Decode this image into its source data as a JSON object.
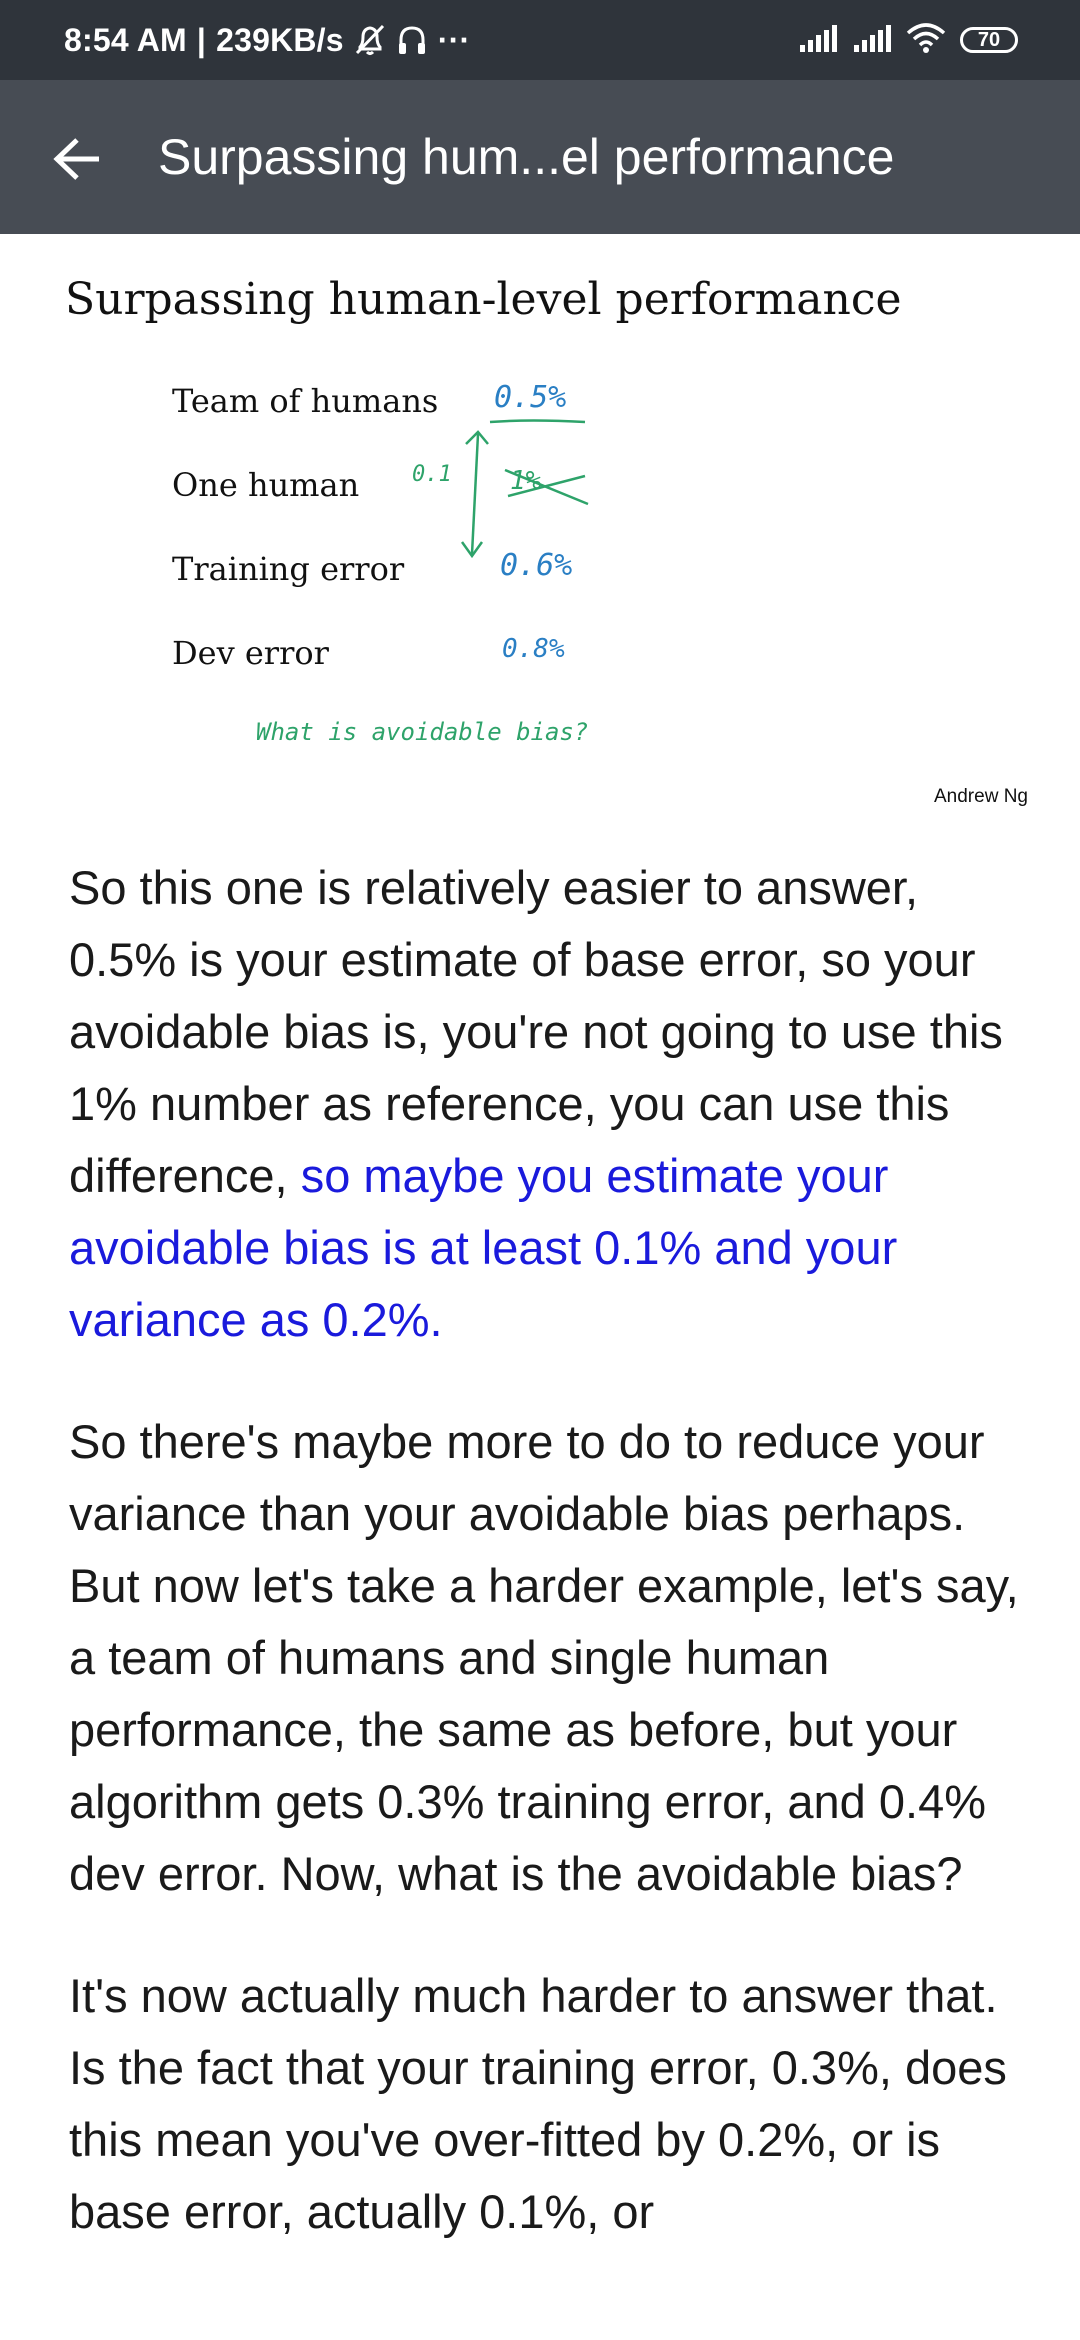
{
  "status_bar": {
    "time": "8:54 AM",
    "separator": "|",
    "speed": "239KB/s",
    "icons": [
      "bell-muted-icon",
      "headphones-icon",
      "more-dots-icon",
      "signal-icon",
      "signal-icon",
      "wifi-icon",
      "battery-icon"
    ],
    "more": "···",
    "battery": "70"
  },
  "app_bar": {
    "back_icon": "arrow-left-icon",
    "title": "Surpassing hum...el performance"
  },
  "slide": {
    "title": "Surpassing human-level performance",
    "rows": [
      {
        "label": "Team of humans",
        "value": "0.5%"
      },
      {
        "label": "One human",
        "value": "1%"
      },
      {
        "label": "Training error",
        "value": "0.6%"
      },
      {
        "label": "Dev error",
        "value": "0.8%"
      }
    ],
    "gap_note": "0.1",
    "question": "What is avoidable bias?",
    "credit": "Andrew Ng",
    "colors": {
      "ink_blue": "#2a7fc4",
      "ink_green": "#2ea36a"
    }
  },
  "article": {
    "p1_plain": "So this one is relatively easier to answer, 0.5% is your estimate of base error, so your avoidable bias is, you're not going to use this 1% number as reference, you can use this difference, ",
    "p1_highlight": "so maybe you estimate your avoidable bias is at least 0.1% and your variance as 0.2%.",
    "p2": "So there's maybe more to do to reduce your variance than your avoidable bias perhaps. But now let's take a harder example, let's say, a team of humans and single human performance, the same as before, but your algorithm gets 0.3% training error, and 0.4% dev error. Now, what is the avoidable bias?",
    "p3": "It's now actually much harder to answer that. Is the fact that your training error, 0.3%, does this mean you've over-fitted by 0.2%, or is base error, actually 0.1%, or",
    "highlight_color": "#1a1adc"
  }
}
